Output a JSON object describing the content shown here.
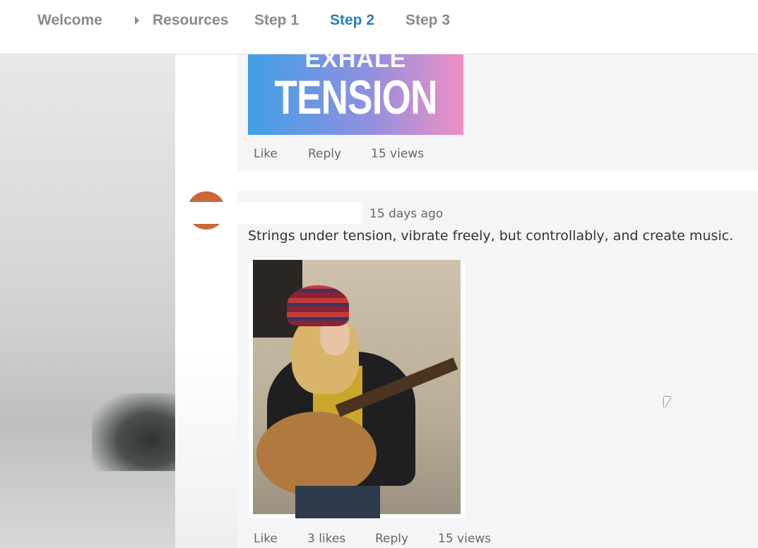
{
  "nav": {
    "items": [
      {
        "label": "Welcome"
      },
      {
        "label": "Resources"
      },
      {
        "label": "Step 1"
      },
      {
        "label": "Step 2",
        "active": true
      },
      {
        "label": "Step 3"
      }
    ],
    "accent": "#2a7bc0"
  },
  "post1": {
    "banner_text": [
      "EXHALE",
      "TENSION"
    ],
    "actions": {
      "like": "Like",
      "reply": "Reply",
      "views": "15 views"
    }
  },
  "post2": {
    "time": "15 days ago",
    "message": "Strings under tension, vibrate freely, but controllably, and create music.",
    "actions": {
      "like": "Like",
      "likes": "3 likes",
      "reply": "Reply",
      "views": "15 views"
    },
    "avatar_color": "#c9683a"
  }
}
